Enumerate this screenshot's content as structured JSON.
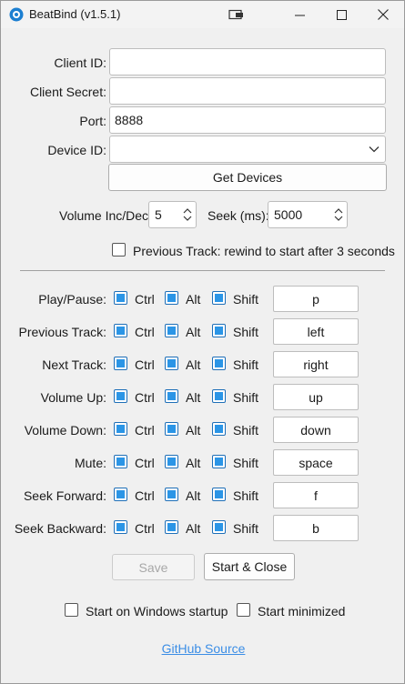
{
  "titlebar": {
    "title": "BeatBind (v1.5.1)"
  },
  "form": {
    "client_id_label": "Client ID:",
    "client_id_value": "",
    "client_secret_label": "Client Secret:",
    "client_secret_value": "",
    "port_label": "Port:",
    "port_value": "8888",
    "device_id_label": "Device ID:",
    "device_id_value": "",
    "get_devices_label": "Get Devices",
    "volume_label": "Volume Inc/Dec:",
    "volume_value": "5",
    "seek_label": "Seek (ms):",
    "seek_value": "5000",
    "prev_track_rewind_label": "Previous Track: rewind to start after 3 seconds"
  },
  "hotkeys": {
    "ctrl_label": "Ctrl",
    "alt_label": "Alt",
    "shift_label": "Shift",
    "rows": [
      {
        "label": "Play/Pause:",
        "key": "p"
      },
      {
        "label": "Previous Track:",
        "key": "left"
      },
      {
        "label": "Next Track:",
        "key": "right"
      },
      {
        "label": "Volume Up:",
        "key": "up"
      },
      {
        "label": "Volume Down:",
        "key": "down"
      },
      {
        "label": "Mute:",
        "key": "space"
      },
      {
        "label": "Seek Forward:",
        "key": "f"
      },
      {
        "label": "Seek Backward:",
        "key": "b"
      }
    ]
  },
  "actions": {
    "save_label": "Save",
    "start_close_label": "Start & Close",
    "startup_label": "Start on Windows startup",
    "minimized_label": "Start minimized",
    "github_label": "GitHub Source"
  },
  "colors": {
    "accent": "#2b95e6",
    "link": "#3c8ee6"
  }
}
